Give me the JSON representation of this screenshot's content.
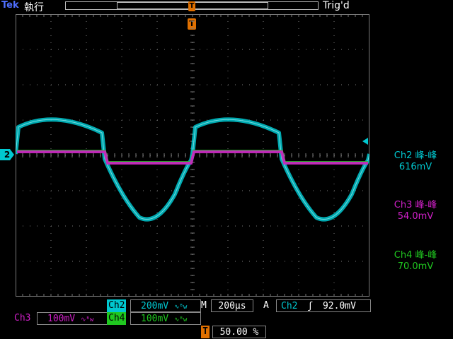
{
  "header": {
    "brand": "Tek",
    "run_state": "執行",
    "trigger_status": "Trig'd",
    "record_marker": "T"
  },
  "trigger_position_marker": "T",
  "ch2_ground_marker": "2",
  "measurements": [
    {
      "channel": "Ch2",
      "label": "Ch2 峰-峰",
      "value": "616mV",
      "color": "#00c8d0"
    },
    {
      "channel": "Ch3",
      "label": "Ch3 峰-峰",
      "value": "54.0mV",
      "color": "#d020c8"
    },
    {
      "channel": "Ch4",
      "label": "Ch4 峰-峰",
      "value": "70.0mV",
      "color": "#20c820"
    }
  ],
  "status": {
    "ch2": {
      "name": "Ch2",
      "scale": "200mV",
      "bw": "∿ᴮw"
    },
    "ch3": {
      "name": "Ch3",
      "scale": "100mV",
      "bw": "∿ᴮw"
    },
    "ch4": {
      "name": "Ch4",
      "scale": "100mV",
      "bw": "∿ᴮw"
    },
    "timebase": {
      "label": "M",
      "value": "200µs"
    },
    "trigger": {
      "mode": "A",
      "source": "Ch2",
      "slope": "ʃ",
      "level": "92.0mV"
    },
    "trigger_position": {
      "marker": "T",
      "value": "50.00 %"
    }
  },
  "colors": {
    "ch2": "#00c8d0",
    "ch3": "#d020c8",
    "ch4": "#20c820",
    "marker": "#e07000",
    "grid": "#7a7a7a"
  },
  "icons": {
    "trigger_marker": "T-marker-icon",
    "ground_marker": "channel-2-ground-icon",
    "trigger_level": "trigger-level-arrow-icon"
  }
}
